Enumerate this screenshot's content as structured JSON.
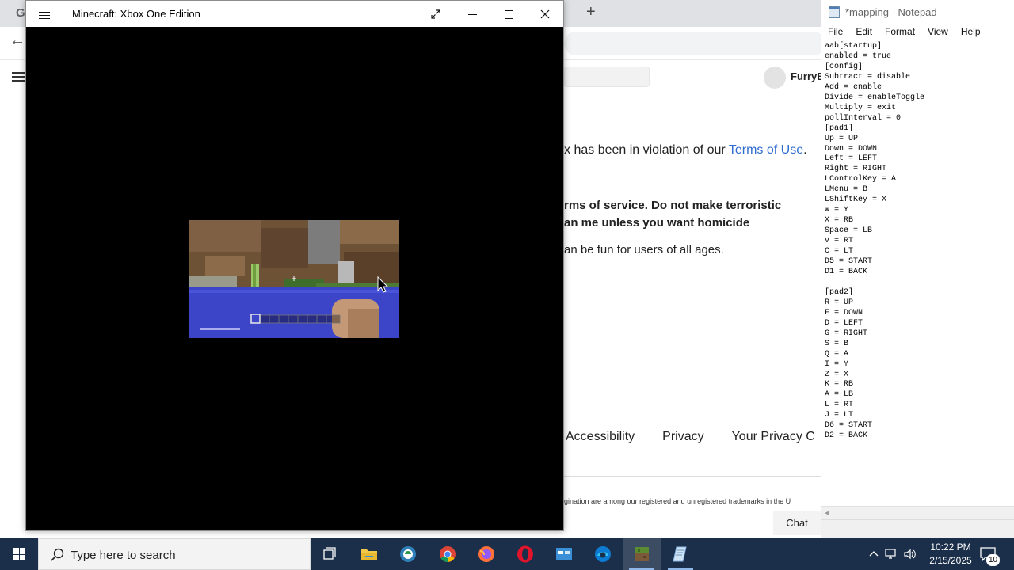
{
  "browser": {
    "tab_initial": "G",
    "new_tab_symbol": "+",
    "back_symbol": "←",
    "username": "FurryB",
    "violation_prefix": "x has been in violation of our ",
    "terms_link": "Terms of Use",
    "violation_suffix": ".",
    "line_2": "rms of service. Do not make terroristic",
    "line_3": "an me unless you want homicide",
    "line_4": "an be fun for users of all ages.",
    "footer_links": [
      "Accessibility",
      "Privacy",
      "Your Privacy C"
    ],
    "legal_text": "gination are among our registered and unregistered trademarks in the U",
    "chat_label": "Chat"
  },
  "minecraft_window": {
    "title": "Minecraft: Xbox One Edition",
    "hotbar_slots": 9,
    "colors": {
      "sky_dirt": "#7a5a3a",
      "water": "#3c44c8",
      "grass": "#4d7a34",
      "stone": "#8f8f8f"
    }
  },
  "notepad": {
    "title": "*mapping - Notepad",
    "menu": [
      "File",
      "Edit",
      "Format",
      "View",
      "Help"
    ],
    "lines": [
      "aab[startup]",
      "enabled = true",
      "[config]",
      "Subtract = disable",
      "Add = enable",
      "Divide = enableToggle",
      "Multiply = exit",
      "pollInterval = 0",
      "[pad1]",
      "Up = UP",
      "Down = DOWN",
      "Left = LEFT",
      "Right = RIGHT",
      "LControlKey = A",
      "LMenu = B",
      "LShiftKey = X",
      "W = Y",
      "X = RB",
      "Space = LB",
      "V = RT",
      "C = LT",
      "D5 = START",
      "D1 = BACK",
      "",
      "[pad2]",
      "R = UP",
      "F = DOWN",
      "D = LEFT",
      "G = RIGHT",
      "S = B",
      "Q = A",
      "I = Y",
      "Z = X",
      "K = RB",
      "A = LB",
      "L = RT",
      "J = LT",
      "D6 = START",
      "D2 = BACK"
    ]
  },
  "taskbar": {
    "search_placeholder": "Type here to search",
    "time": "10:22 PM",
    "date": "2/15/2025",
    "notification_count": "10",
    "apps": [
      "task-view",
      "file-explorer",
      "app-green",
      "chrome",
      "firefox",
      "opera",
      "app-blue",
      "edge",
      "minecraft",
      "notepad"
    ],
    "colors": {
      "taskbar_bg": "#1b2f4a",
      "accent": "#8fb8e8"
    }
  }
}
